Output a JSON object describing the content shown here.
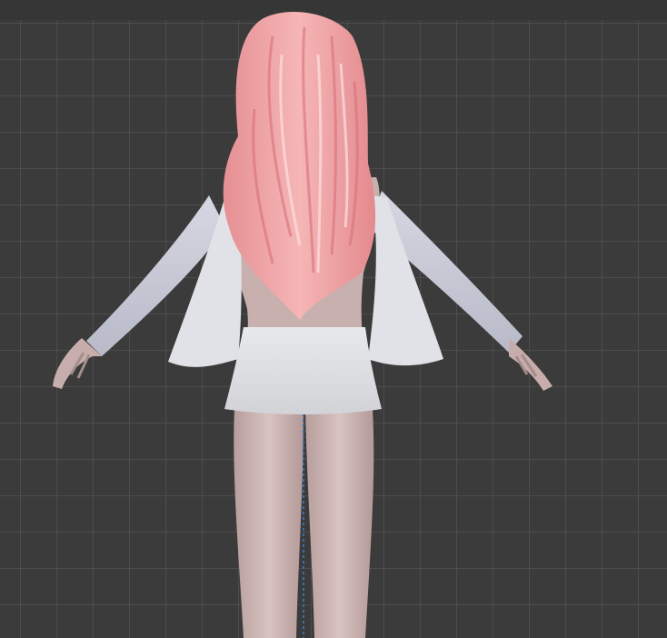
{
  "viewport": {
    "background_color": "#3b3b3b",
    "grid_color": "#5a5a5a"
  },
  "model": {
    "hair_color": "#f0a3a3",
    "skin_color": "#c9b2b0",
    "dress_color": "#e4e5e9",
    "sleeve_color": "#cfd0dc",
    "origin_axis_color": "#3c6fa8"
  }
}
